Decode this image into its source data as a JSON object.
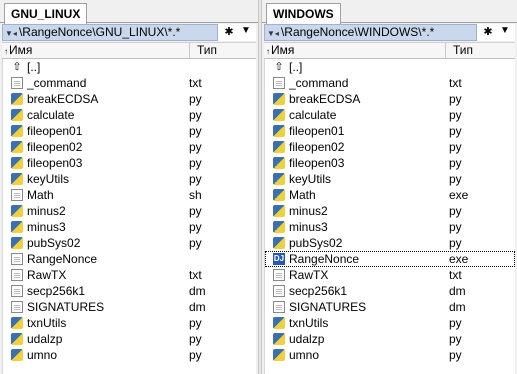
{
  "left_panel": {
    "tab_title": "GNU_LINUX",
    "path": "\\RangeNonce\\GNU_LINUX\\*.*",
    "header_name": "Имя",
    "header_type": "Тип",
    "files": [
      {
        "name": "[..]",
        "type": "",
        "icon": "up-folder-icon"
      },
      {
        "name": "_command",
        "type": "txt",
        "icon": "text-file-icon"
      },
      {
        "name": "breakECDSA",
        "type": "py",
        "icon": "python-file-icon"
      },
      {
        "name": "calculate",
        "type": "py",
        "icon": "python-file-icon"
      },
      {
        "name": "fileopen01",
        "type": "py",
        "icon": "python-file-icon"
      },
      {
        "name": "fileopen02",
        "type": "py",
        "icon": "python-file-icon"
      },
      {
        "name": "fileopen03",
        "type": "py",
        "icon": "python-file-icon"
      },
      {
        "name": "keyUtils",
        "type": "py",
        "icon": "python-file-icon"
      },
      {
        "name": "Math",
        "type": "sh",
        "icon": "text-file-icon"
      },
      {
        "name": "minus2",
        "type": "py",
        "icon": "python-file-icon"
      },
      {
        "name": "minus3",
        "type": "py",
        "icon": "python-file-icon"
      },
      {
        "name": "pubSys02",
        "type": "py",
        "icon": "python-file-icon"
      },
      {
        "name": "RangeNonce",
        "type": "",
        "icon": "text-file-icon"
      },
      {
        "name": "RawTX",
        "type": "txt",
        "icon": "text-file-icon"
      },
      {
        "name": "secp256k1",
        "type": "dm",
        "icon": "text-file-icon"
      },
      {
        "name": "SIGNATURES",
        "type": "dm",
        "icon": "text-file-icon"
      },
      {
        "name": "txnUtils",
        "type": "py",
        "icon": "python-file-icon"
      },
      {
        "name": "udalzp",
        "type": "py",
        "icon": "python-file-icon"
      },
      {
        "name": "umno",
        "type": "py",
        "icon": "python-file-icon"
      }
    ]
  },
  "right_panel": {
    "tab_title": "WINDOWS",
    "path": "\\RangeNonce\\WINDOWS\\*.*",
    "header_name": "Имя",
    "header_type": "Тип",
    "files": [
      {
        "name": "[..]",
        "type": "",
        "icon": "up-folder-icon"
      },
      {
        "name": "_command",
        "type": "txt",
        "icon": "text-file-icon"
      },
      {
        "name": "breakECDSA",
        "type": "py",
        "icon": "python-file-icon"
      },
      {
        "name": "calculate",
        "type": "py",
        "icon": "python-file-icon"
      },
      {
        "name": "fileopen01",
        "type": "py",
        "icon": "python-file-icon"
      },
      {
        "name": "fileopen02",
        "type": "py",
        "icon": "python-file-icon"
      },
      {
        "name": "fileopen03",
        "type": "py",
        "icon": "python-file-icon"
      },
      {
        "name": "keyUtils",
        "type": "py",
        "icon": "python-file-icon"
      },
      {
        "name": "Math",
        "type": "exe",
        "icon": "python-file-icon"
      },
      {
        "name": "minus2",
        "type": "py",
        "icon": "python-file-icon"
      },
      {
        "name": "minus3",
        "type": "py",
        "icon": "python-file-icon"
      },
      {
        "name": "pubSys02",
        "type": "py",
        "icon": "python-file-icon"
      },
      {
        "name": "RangeNonce",
        "type": "exe",
        "icon": "exe-file-icon",
        "selected": true
      },
      {
        "name": "RawTX",
        "type": "txt",
        "icon": "text-file-icon"
      },
      {
        "name": "secp256k1",
        "type": "dm",
        "icon": "text-file-icon"
      },
      {
        "name": "SIGNATURES",
        "type": "dm",
        "icon": "text-file-icon"
      },
      {
        "name": "txnUtils",
        "type": "py",
        "icon": "python-file-icon"
      },
      {
        "name": "udalzp",
        "type": "py",
        "icon": "python-file-icon"
      },
      {
        "name": "umno",
        "type": "py",
        "icon": "python-file-icon"
      }
    ]
  }
}
